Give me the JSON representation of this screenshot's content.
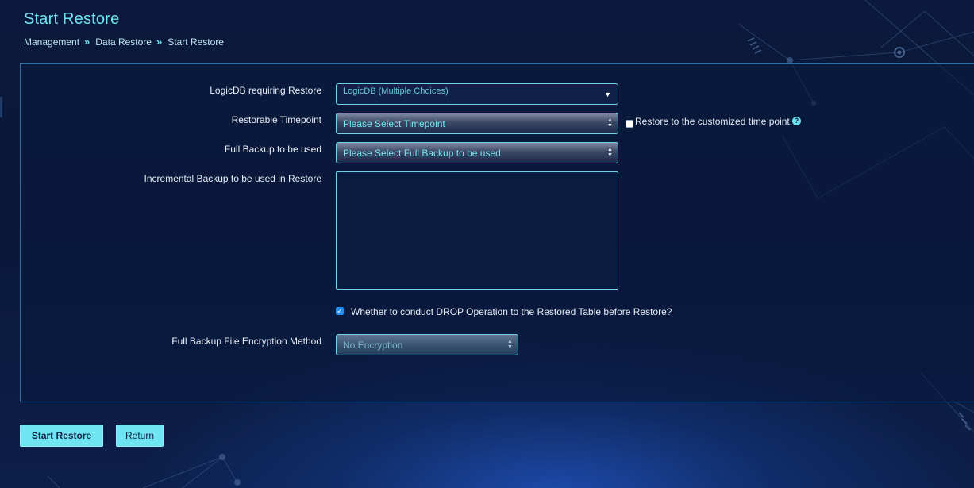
{
  "header": {
    "title": "Start Restore"
  },
  "breadcrumb": {
    "items": [
      "Management",
      "Data Restore",
      "Start Restore"
    ],
    "separator": "»"
  },
  "form": {
    "logicdb": {
      "label": "LogicDB requiring Restore",
      "placeholder": "LogicDB (Multiple Choices)"
    },
    "timepoint": {
      "label": "Restorable Timepoint",
      "value": "Please Select Timepoint",
      "custom_checkbox_label": "Restore to the customized time point.",
      "custom_checked": false,
      "help_glyph": "?"
    },
    "full_backup": {
      "label": "Full Backup to be used",
      "value": "Please Select Full Backup to be used"
    },
    "incremental_backup": {
      "label": "Incremental Backup to be used in Restore",
      "value": ""
    },
    "drop_operation": {
      "label": "Whether to conduct DROP Operation to the Restored Table before Restore?",
      "checked": true
    },
    "encryption": {
      "label": "Full Backup File Encryption Method",
      "value": "No Encryption"
    }
  },
  "actions": {
    "start_label": "Start Restore",
    "return_label": "Return"
  },
  "icons": {
    "caret": "dropdown-caret-icon",
    "updown": "select-arrows-icon",
    "help": "help-icon",
    "check": "checkmark-icon"
  },
  "colors": {
    "accent": "#6fe0ef",
    "background": "#0b1a3c",
    "panel_border": "#2b6fa8",
    "checkbox_checked": "#1e8cf0"
  }
}
